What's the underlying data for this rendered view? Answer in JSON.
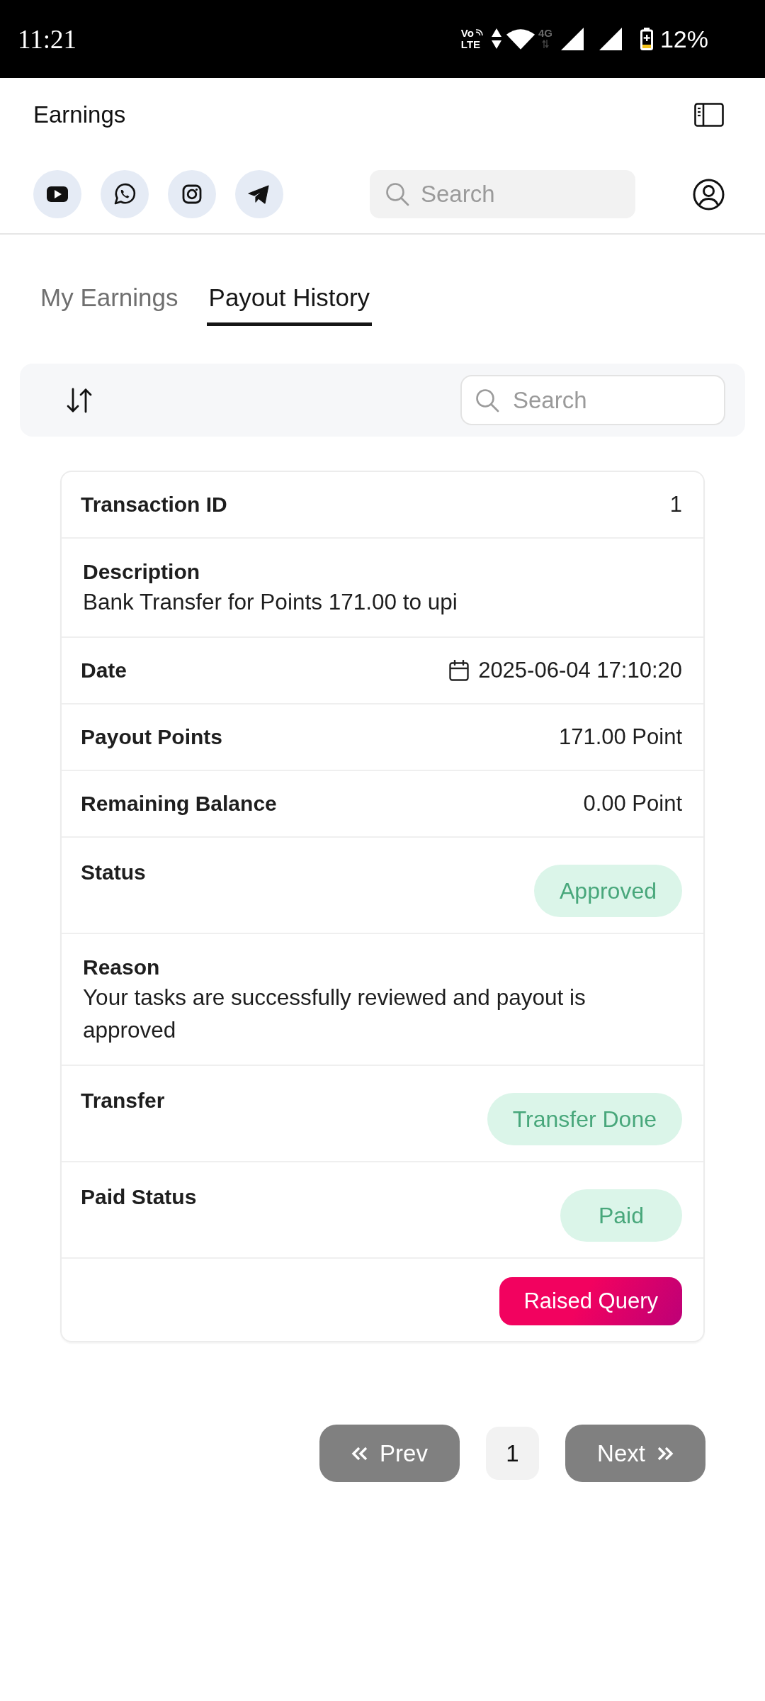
{
  "status_bar": {
    "time": "11:21",
    "network_mode_top": "Vo",
    "network_mode_bottom": "LTE",
    "network_type": "4G",
    "battery": "12%"
  },
  "header": {
    "title": "Earnings",
    "search": {
      "placeholder": "Search"
    }
  },
  "tabs": [
    {
      "label": "My Earnings",
      "selected": false
    },
    {
      "label": "Payout History",
      "selected": true
    }
  ],
  "toolbar": {
    "search": {
      "placeholder": "Search"
    }
  },
  "transaction": {
    "rows": [
      {
        "kind": "field",
        "label": "Transaction ID",
        "value": "1"
      },
      {
        "kind": "text",
        "label": "Description",
        "value": "Bank Transfer for Points 171.00 to upi"
      },
      {
        "kind": "date",
        "label": "Date",
        "value": "2025-06-04 17:10:20"
      },
      {
        "kind": "field",
        "label": "Payout Points",
        "value": "171.00 Point"
      },
      {
        "kind": "field",
        "label": "Remaining Balance",
        "value": "0.00 Point"
      },
      {
        "kind": "badge",
        "label": "Status",
        "value": "Approved"
      },
      {
        "kind": "text",
        "label": "Reason",
        "value": "Your tasks are successfully reviewed and payout is approved"
      },
      {
        "kind": "badge",
        "label": "Transfer",
        "value": "Transfer Done"
      },
      {
        "kind": "badge",
        "label": "Paid Status",
        "value": "Paid"
      }
    ],
    "action": {
      "label": "Raised Query"
    }
  },
  "pagination": {
    "prev": {
      "label": "Prev",
      "disabled": true
    },
    "pages": [
      {
        "label": "1",
        "selected": true
      }
    ],
    "next": {
      "label": "Next",
      "disabled": true
    }
  }
}
